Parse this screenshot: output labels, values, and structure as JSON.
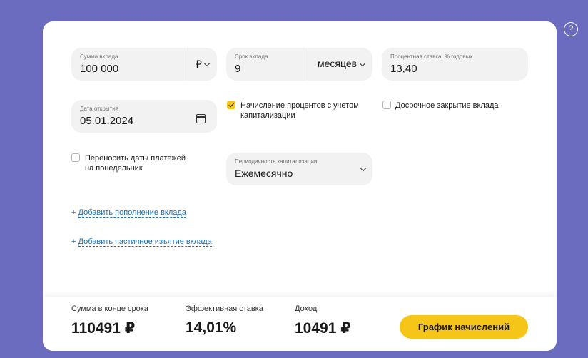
{
  "help": {
    "label": "?"
  },
  "form": {
    "amount": {
      "label": "Сумма вклада",
      "value": "100 000",
      "currency": "₽"
    },
    "term": {
      "label": "Срок вклада",
      "value": "9",
      "unit": "месяцев"
    },
    "rate": {
      "label": "Процентная ставка, % годовых",
      "value": "13,40"
    },
    "open_date": {
      "label": "Дата открытия",
      "value": "05.01.2024"
    },
    "capitalization": {
      "label": "Начисление процентов с учетом капитализации",
      "checked": true
    },
    "early_close": {
      "label": "Досрочное закрытие вклада",
      "checked": false
    },
    "move_dates": {
      "label": "Переносить даты платежей на понедельник",
      "checked": false
    },
    "cap_period": {
      "label": "Периодичность капитализации",
      "value": "Ежемесячно"
    },
    "add_deposit_link": {
      "prefix": "+",
      "label": "Добавить пополнение вклада"
    },
    "add_withdrawal_link": {
      "prefix": "+",
      "label": "Добавить частичное изъятие вклада"
    }
  },
  "summary": {
    "end_sum": {
      "label": "Сумма в конце срока",
      "value": "110491 ₽"
    },
    "effective_rate": {
      "label": "Эффективная ставка",
      "value": "14,01%"
    },
    "income": {
      "label": "Доход",
      "value": "10491 ₽"
    },
    "schedule_button": "График начислений"
  },
  "colors": {
    "background": "#6b6bbf",
    "accent": "#f5c518",
    "link": "#1f6fb2",
    "field_bg": "#f2f2f2"
  }
}
